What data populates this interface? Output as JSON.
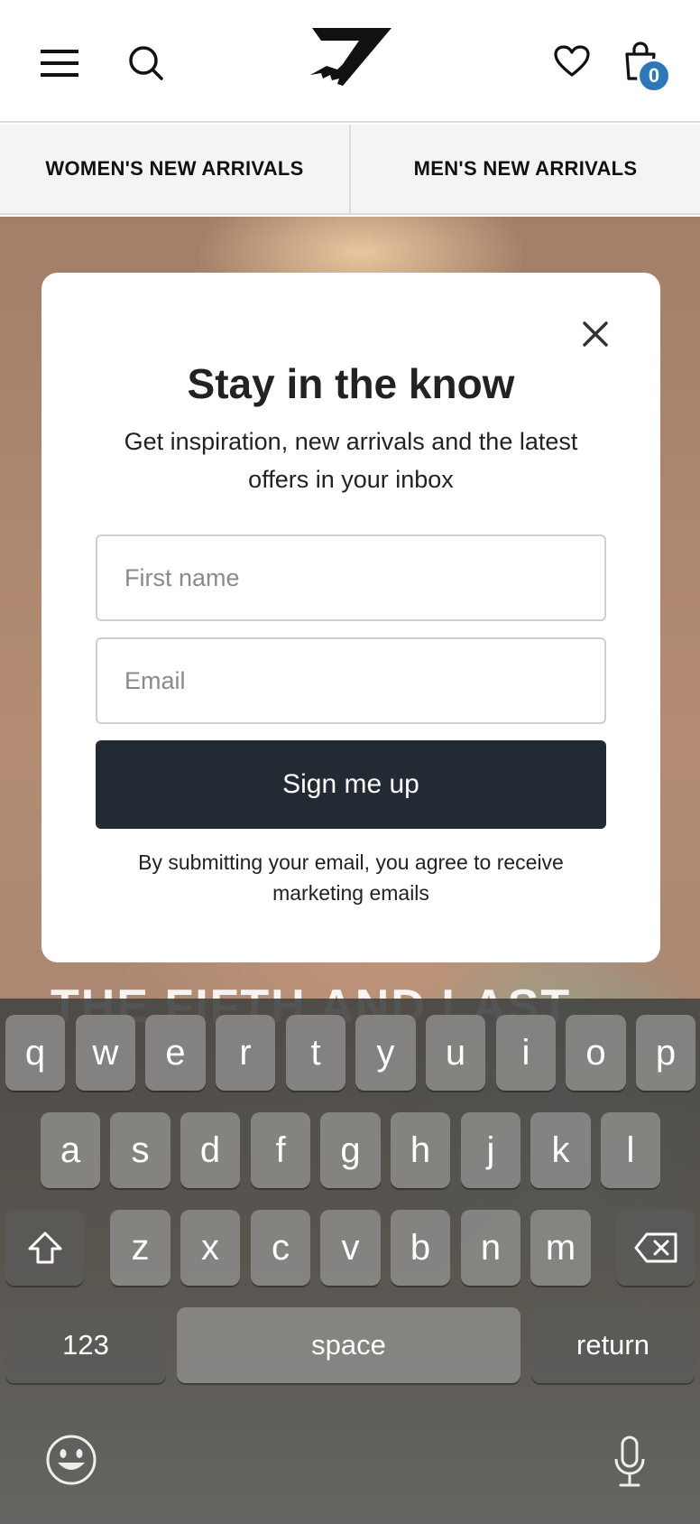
{
  "header": {
    "cart_count": "0"
  },
  "nav": {
    "tabs": [
      {
        "label": "WOMEN'S NEW ARRIVALS"
      },
      {
        "label": "MEN'S NEW ARRIVALS"
      }
    ]
  },
  "hero": {
    "headline": "THE FIFTH AND LAST"
  },
  "modal": {
    "title": "Stay in the know",
    "subtitle": "Get inspiration, new arrivals and the latest offers in your inbox",
    "first_name_placeholder": "First name",
    "email_placeholder": "Email",
    "submit_label": "Sign me up",
    "legal": "By submitting your email, you agree to receive marketing emails"
  },
  "keyboard": {
    "row1": [
      "q",
      "w",
      "e",
      "r",
      "t",
      "y",
      "u",
      "i",
      "o",
      "p"
    ],
    "row2": [
      "a",
      "s",
      "d",
      "f",
      "g",
      "h",
      "j",
      "k",
      "l"
    ],
    "row3": [
      "z",
      "x",
      "c",
      "v",
      "b",
      "n",
      "m"
    ],
    "numbers_label": "123",
    "space_label": "space",
    "return_label": "return"
  },
  "colors": {
    "badge": "#2f78b8",
    "button": "#222a33"
  }
}
